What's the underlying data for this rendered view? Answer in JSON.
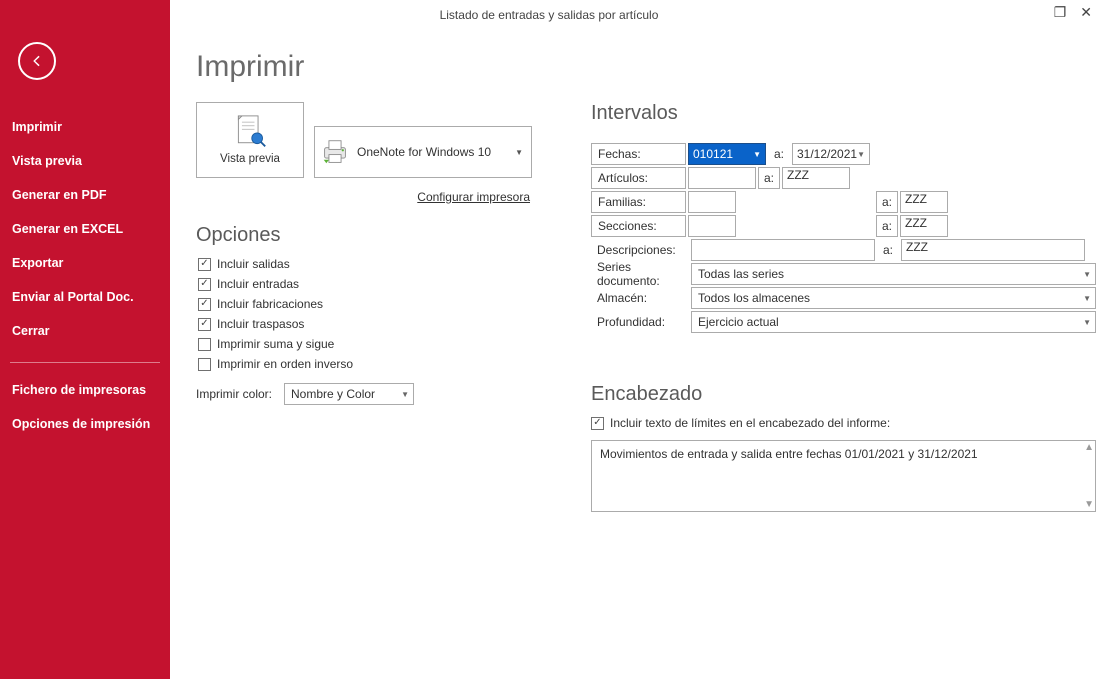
{
  "window": {
    "title": "Listado de entradas y salidas por artículo"
  },
  "sidebar": {
    "items": [
      "Imprimir",
      "Vista previa",
      "Generar en PDF",
      "Generar en EXCEL",
      "Exportar",
      "Enviar al Portal Doc.",
      "Cerrar"
    ],
    "bottom": [
      "Fichero de impresoras",
      "Opciones de impresión"
    ]
  },
  "page": {
    "heading": "Imprimir",
    "preview_label": "Vista previa",
    "printer": "OneNote for Windows 10",
    "configure_link": "Configurar impresora"
  },
  "options": {
    "heading": "Opciones",
    "checks": [
      {
        "label": "Incluir salidas",
        "checked": true
      },
      {
        "label": "Incluir entradas",
        "checked": true
      },
      {
        "label": "Incluir fabricaciones",
        "checked": true
      },
      {
        "label": "Incluir traspasos",
        "checked": true
      },
      {
        "label": "Imprimir suma y sigue",
        "checked": false
      },
      {
        "label": "Imprimir en orden inverso",
        "checked": false
      }
    ],
    "color_label": "Imprimir color:",
    "color_value": "Nombre y Color"
  },
  "intervals": {
    "heading": "Intervalos",
    "to": "a:",
    "rows": {
      "fechas": {
        "label": "Fechas:",
        "from": "010121",
        "to": "31/12/2021"
      },
      "articulos": {
        "label": "Artículos:",
        "from": "",
        "to": "ZZZ"
      },
      "familias": {
        "label": "Familias:",
        "from": "",
        "to": "ZZZ"
      },
      "secciones": {
        "label": "Secciones:",
        "from": "",
        "to": "ZZZ"
      },
      "descripciones": {
        "label": "Descripciones:",
        "from": "",
        "to": "ZZZ"
      }
    },
    "series": {
      "label": "Series documento:",
      "value": "Todas las series"
    },
    "almacen": {
      "label": "Almacén:",
      "value": "Todos los almacenes"
    },
    "profundidad": {
      "label": "Profundidad:",
      "value": "Ejercicio actual"
    }
  },
  "header": {
    "heading": "Encabezado",
    "check_label": "Incluir texto de límites en el encabezado del informe:",
    "checked": true,
    "text": "Movimientos de entrada y salida entre fechas 01/01/2021 y 31/12/2021"
  }
}
